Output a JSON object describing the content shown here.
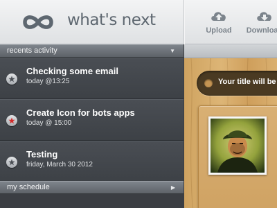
{
  "app": {
    "name": "what's next",
    "logo_icon": "infinity-icon"
  },
  "toolbar": {
    "upload_label": "Upload",
    "upload_icon": "cloud-upload-icon",
    "download_label": "Download",
    "download_icon": "cloud-download-icon"
  },
  "recents": {
    "header": "recents activity",
    "items": [
      {
        "title": "Checking some email",
        "subtitle": "today @13:25",
        "star": "inactive"
      },
      {
        "title": "Create Icon for bots apps",
        "subtitle": "today @ 15:00",
        "star": "active"
      },
      {
        "title": "Testing",
        "subtitle": "friday, March 30 2012",
        "star": "inactive"
      }
    ]
  },
  "schedule": {
    "header": "my schedule"
  },
  "board": {
    "title_placeholder": "Your title will be here"
  },
  "colors": {
    "brand_text": "#5e6770",
    "star_active": "#d42a2a",
    "star_inactive": "#4a4e54",
    "wood": "#d6ab6b"
  }
}
